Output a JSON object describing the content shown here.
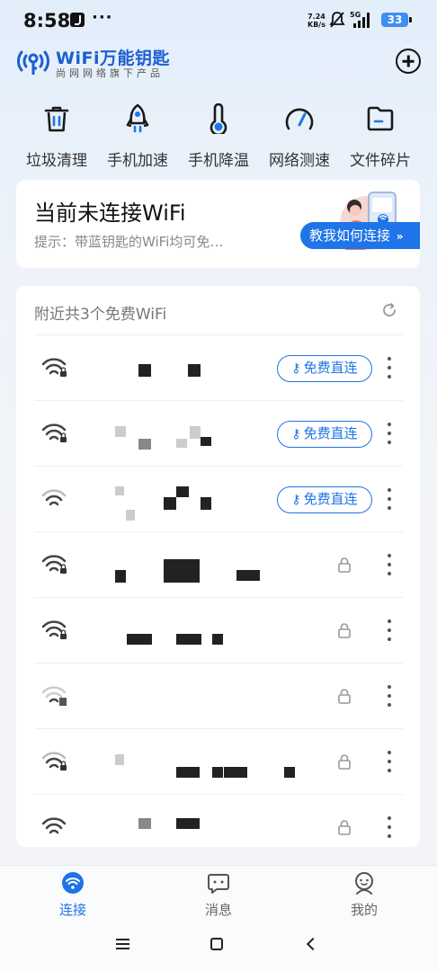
{
  "status_bar": {
    "time": "8:58",
    "more": "···",
    "speed_value": "7.24",
    "speed_unit": "KB/s",
    "network": "5G",
    "battery": "33"
  },
  "header": {
    "brand_title": "WiFi万能钥匙",
    "brand_subtitle": "尚网网络旗下产品",
    "add_icon": "plus-circle-icon"
  },
  "tools": [
    {
      "label": "垃圾清理",
      "icon": "trash-icon"
    },
    {
      "label": "手机加速",
      "icon": "rocket-icon"
    },
    {
      "label": "手机降温",
      "icon": "thermometer-icon"
    },
    {
      "label": "网络测速",
      "icon": "speedometer-icon"
    },
    {
      "label": "文件碎片",
      "icon": "folder-icon"
    }
  ],
  "connect_card": {
    "title": "当前未连接WiFi",
    "hint": "提示：带蓝钥匙的WiFi均可免…",
    "button_label": "教我如何连接",
    "button_chevron": "»"
  },
  "nearby": {
    "title": "附近共3个免费WiFi",
    "refresh_icon": "refresh-icon",
    "free_label": "免费直连",
    "networks": [
      {
        "free": true,
        "signal": "strong",
        "secured": true
      },
      {
        "free": true,
        "signal": "strong",
        "secured": true
      },
      {
        "free": true,
        "signal": "medium",
        "secured": false
      },
      {
        "free": false,
        "signal": "strong",
        "secured": true
      },
      {
        "free": false,
        "signal": "strong",
        "secured": true
      },
      {
        "free": false,
        "signal": "weak",
        "secured": true
      },
      {
        "free": false,
        "signal": "medium",
        "secured": true
      },
      {
        "free": false,
        "signal": "medium",
        "secured": true
      }
    ]
  },
  "bottom_nav": [
    {
      "label": "连接",
      "icon": "wifi-icon",
      "active": true
    },
    {
      "label": "消息",
      "icon": "chat-icon",
      "active": false
    },
    {
      "label": "我的",
      "icon": "profile-icon",
      "active": false
    }
  ],
  "colors": {
    "brand_blue": "#1e74e8",
    "background": "#eef3fa"
  }
}
